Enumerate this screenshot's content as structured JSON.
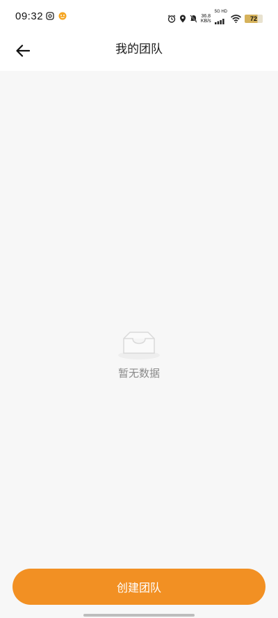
{
  "status_bar": {
    "time": "09:32",
    "net_speed_value": "36.8",
    "net_speed_unit": "KB/s",
    "network_type": "5G HD",
    "battery_level": "72",
    "icons": [
      "photo-icon",
      "app-notification-icon",
      "alarm-icon",
      "location-icon",
      "mute-icon",
      "signal-icon",
      "wifi-icon",
      "battery-icon"
    ]
  },
  "header": {
    "title": "我的团队",
    "back_icon": "arrow-left-icon"
  },
  "empty_state": {
    "icon": "empty-inbox-icon",
    "message": "暂无数据"
  },
  "footer": {
    "create_button_label": "创建团队"
  },
  "colors": {
    "accent": "#f29023",
    "background": "#f7f7f7",
    "empty_text": "#8a8a8a"
  }
}
